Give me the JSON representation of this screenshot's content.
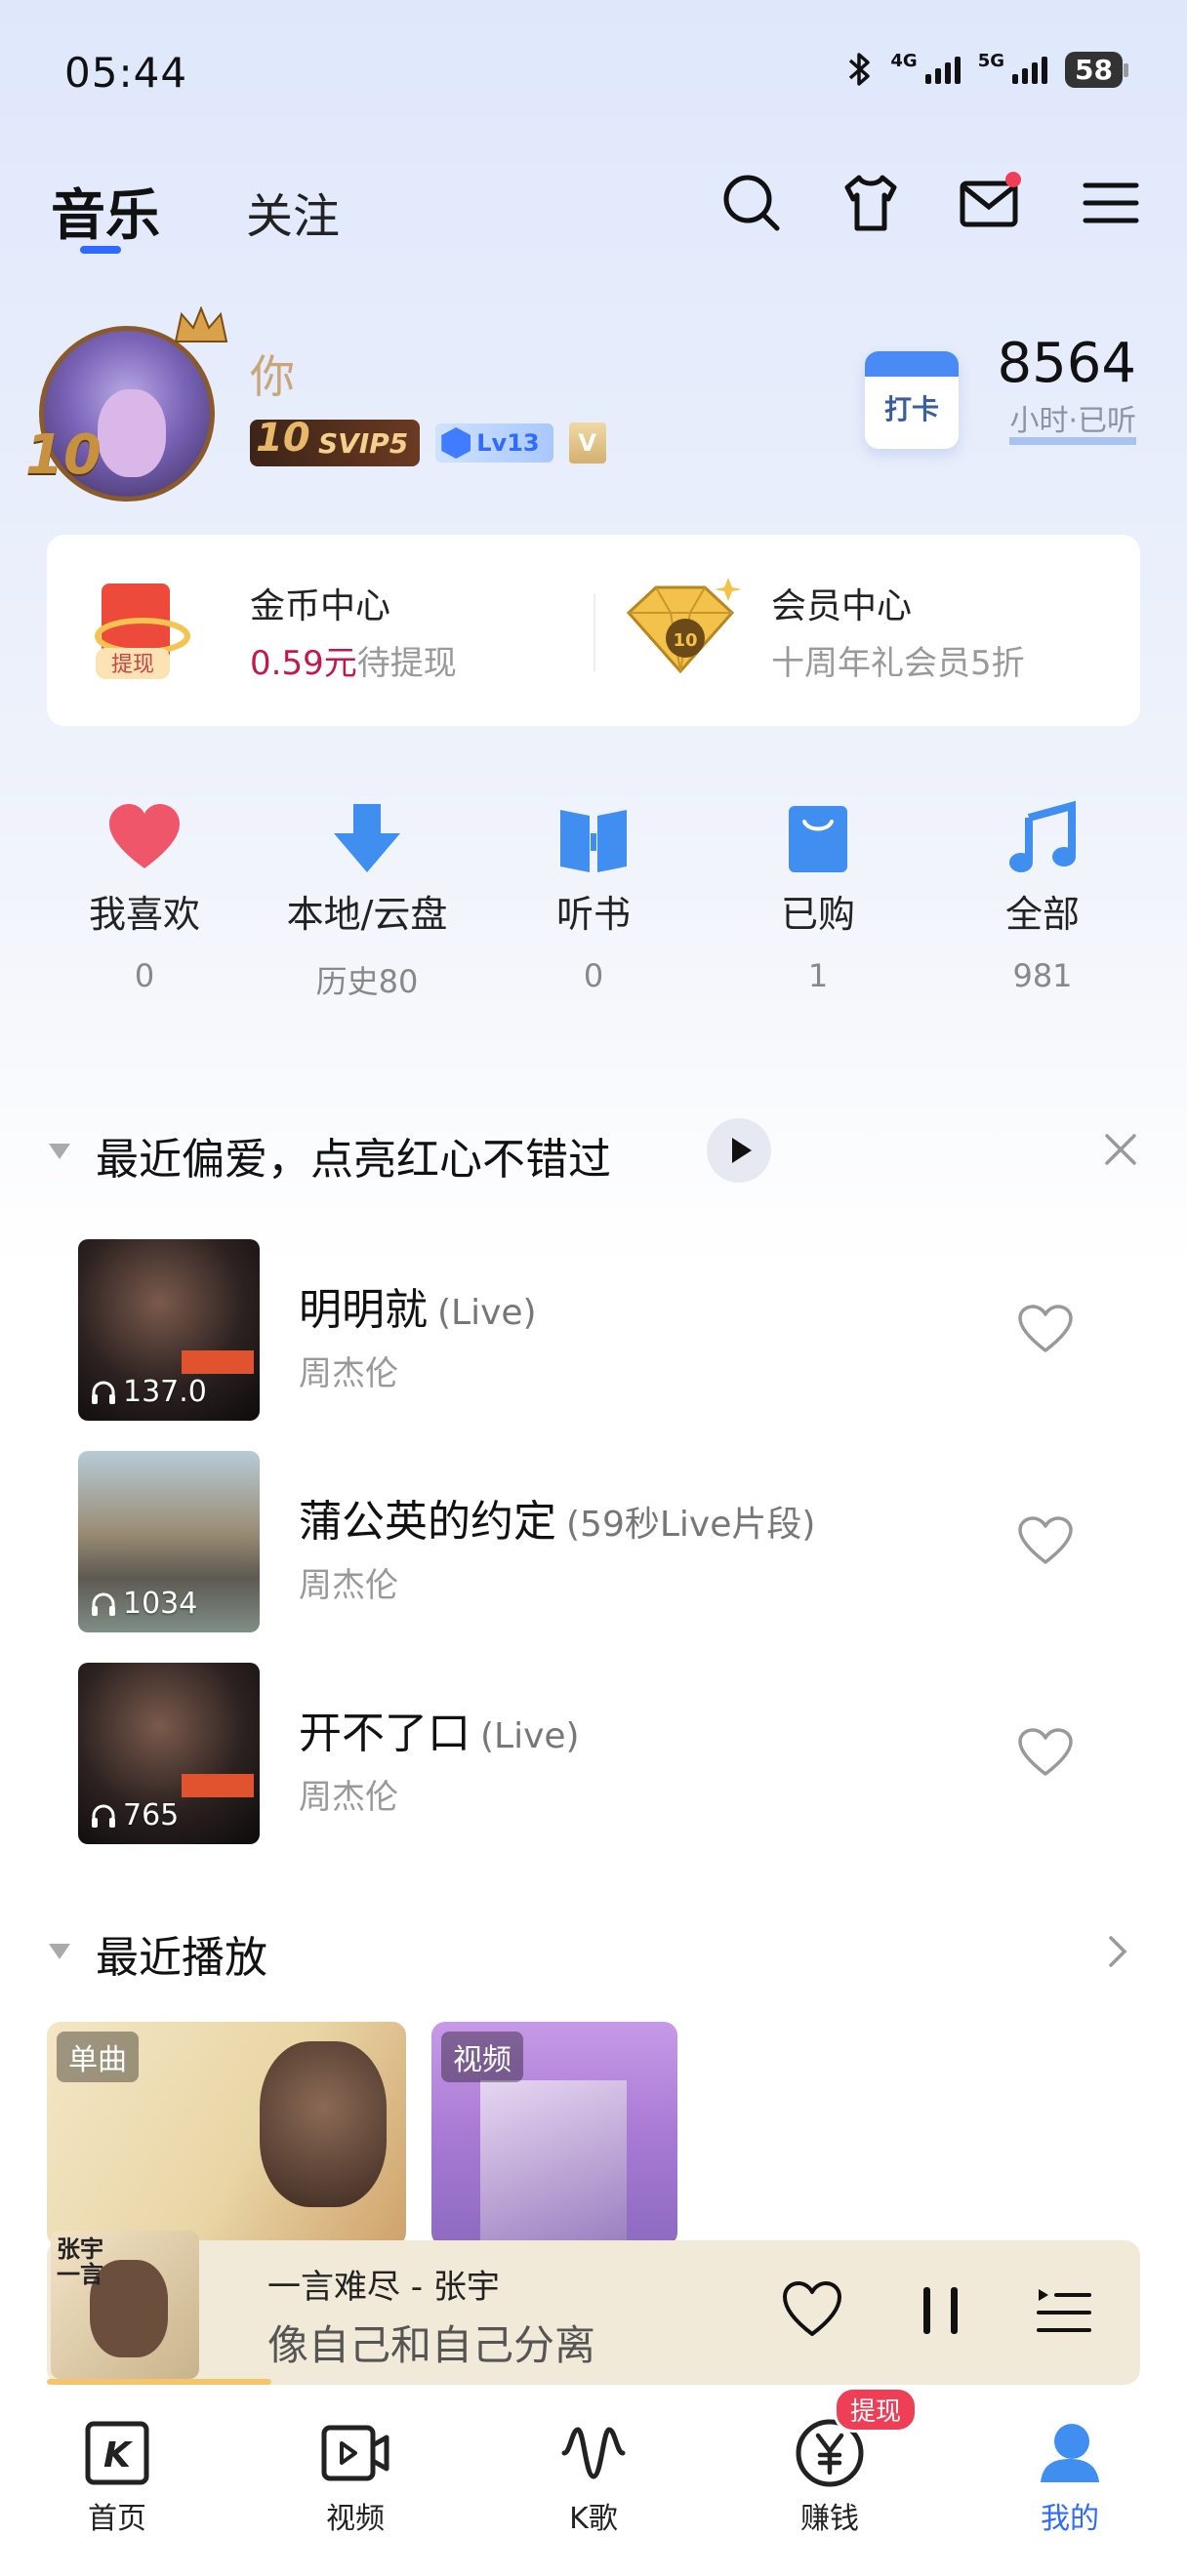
{
  "status": {
    "time": "05:44",
    "network1": "4G",
    "network2": "5G",
    "battery": "58"
  },
  "top_tabs": {
    "active": "音乐",
    "other": "关注"
  },
  "profile": {
    "username": "你",
    "svip": "SVIP5",
    "level": "Lv13",
    "v_badge": "V",
    "checkin_label": "打卡",
    "hours": "8564",
    "hours_label": "小时·已听"
  },
  "cards": {
    "coin": {
      "icon_text": "提现",
      "title": "金币中心",
      "amount": "0.59元",
      "suffix": "待提现"
    },
    "vip": {
      "title": "会员中心",
      "subtitle": "十周年礼会员5折"
    }
  },
  "quick": [
    {
      "label": "我喜欢",
      "count": "0",
      "icon": "heart-icon"
    },
    {
      "label": "本地/云盘",
      "count": "历史80",
      "icon": "download-icon"
    },
    {
      "label": "听书",
      "count": "0",
      "icon": "book-icon"
    },
    {
      "label": "已购",
      "count": "1",
      "icon": "bag-icon"
    },
    {
      "label": "全部",
      "count": "981",
      "icon": "music-note-icon"
    }
  ],
  "favorites": {
    "title": "最近偏爱，点亮红心不错过",
    "songs": [
      {
        "title": "明明就",
        "tag": "(Live)",
        "artist": "周杰伦",
        "plays": "137.0"
      },
      {
        "title": "蒲公英的约定",
        "tag": "(59秒Live片段)",
        "artist": "周杰伦",
        "plays": "1034"
      },
      {
        "title": "开不了口",
        "tag": "(Live)",
        "artist": "周杰伦",
        "plays": "765"
      }
    ]
  },
  "recent": {
    "title": "最近播放",
    "items": [
      {
        "type": "单曲"
      },
      {
        "type": "视频"
      }
    ]
  },
  "player": {
    "cover_text": "张宇\n一言",
    "title": "一言难尽 - 张宇",
    "lyric": "像自己和自己分离"
  },
  "nav": [
    {
      "label": "首页",
      "icon": "k-home-icon"
    },
    {
      "label": "视频",
      "icon": "video-icon"
    },
    {
      "label": "K歌",
      "icon": "k-song-icon"
    },
    {
      "label": "赚钱",
      "icon": "yen-icon"
    },
    {
      "label": "我的",
      "icon": "user-icon"
    }
  ],
  "nav_badge": "提现",
  "colors": {
    "accent": "#2f6bff",
    "heart": "#f0566a",
    "amount": "#c2184b"
  }
}
